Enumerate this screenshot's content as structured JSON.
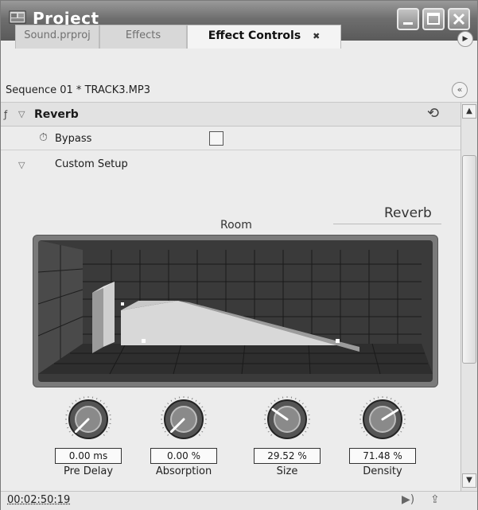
{
  "window": {
    "title": "Project"
  },
  "tabs": [
    {
      "label": "Sound.prproj"
    },
    {
      "label": "Effects"
    },
    {
      "label": "Effect Controls",
      "close": "✖"
    }
  ],
  "sequence": {
    "label": "Sequence 01 * TRACK3.MP3"
  },
  "effect": {
    "name": "Reverb",
    "bypass_label": "Bypass",
    "bypass_checked": false,
    "custom_setup_label": "Custom Setup",
    "room_label": "Room",
    "reverb_tag": "Reverb"
  },
  "knobs": [
    {
      "value": "0.00 ms",
      "label": "Pre Delay",
      "level": 0.0
    },
    {
      "value": "0.00 %",
      "label": "Absorption",
      "level": 0.0
    },
    {
      "value": "29.52 %",
      "label": "Size",
      "level": 0.2952
    },
    {
      "value": "71.48 %",
      "label": "Density",
      "level": 0.7148
    }
  ],
  "footer": {
    "timecode": "00:02:50:19"
  },
  "icons": {
    "title": "project-window-icon",
    "panel_menu": "panel-menu-icon",
    "collapse": "collapse-icon",
    "reset": "reset-icon",
    "bypass": "stopwatch-icon",
    "play": "play-audio-icon",
    "export": "export-icon"
  }
}
